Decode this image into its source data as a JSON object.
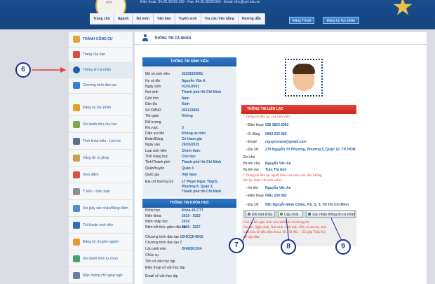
{
  "header": {
    "contact": "Điện thoại: 84.28.38295.299 - Fax: 84.28.38250359 - Email: tthc@uef.edu.vn",
    "logo_year": "1976",
    "nav": [
      "Trang chủ",
      "Ngành",
      "Bộ môn",
      "Văn bản",
      "Tuyển sinh",
      "Tra cứu Văn bằng",
      "Hướng dẫn"
    ],
    "logout": "Đăng Thoát",
    "register": "Đăng ký học phần"
  },
  "sidebar": {
    "items": [
      {
        "label": "THÀNH CÔNG CỤ",
        "icon": "tools-icon"
      },
      {
        "label": "Trang của bạn",
        "icon": "home-icon"
      },
      {
        "label": "Thông tin cá nhân",
        "icon": "user-icon"
      },
      {
        "label": "Chương trình đào tạo",
        "icon": "program-icon"
      },
      {
        "label": "Đăng ký học phần",
        "icon": "pencil-icon"
      },
      {
        "label": "Ghi danh nhu cầu học",
        "icon": "notebook-icon"
      },
      {
        "label": "Thời khóa biểu - Lịch thi",
        "icon": "calendar-icon"
      },
      {
        "label": "Vắng thi có phép",
        "icon": "absence-icon"
      },
      {
        "label": "Xem điểm",
        "icon": "grades-icon"
      },
      {
        "label": "Ý kiến - thảo luận",
        "icon": "discussion-icon"
      },
      {
        "label": "Xin giấy xác nhận/Bảng điểm",
        "icon": "certificate-icon"
      },
      {
        "label": "Tài khoản sinh viên",
        "icon": "account-icon"
      },
      {
        "label": "Đăng ký chuyên ngành",
        "icon": "major-icon"
      },
      {
        "label": "Ghi danh môn tự chọn",
        "icon": "elective-icon"
      },
      {
        "label": "Nộp chứng chỉ ngoại ngữ",
        "icon": "language-icon"
      }
    ]
  },
  "main": {
    "title": "THÔNG TIN CÁ NHÂN",
    "student_head": "THÔNG TIN SINH VIÊN",
    "student_rows": [
      {
        "label": "Mã số sinh viên",
        "value": "31191020001"
      },
      {
        "label": "Họ và tên",
        "value": "Nguyễn Văn A"
      },
      {
        "label": "Ngày sinh",
        "value": "01/01/2001"
      },
      {
        "label": "Nơi sinh",
        "value": "Thành phố Hồ Chí Minh"
      },
      {
        "label": "Giới tính",
        "value": "Nam"
      },
      {
        "label": "Dân tộc",
        "value": "Kinh"
      },
      {
        "label": "Số CMND",
        "value": "025123456"
      },
      {
        "label": "Tôn giáo",
        "value": "Không"
      },
      {
        "label": "Đối tượng",
        "value": ""
      },
      {
        "label": "Khu vực",
        "value": "3"
      },
      {
        "label": "Diện ưu tiên",
        "value": "Không ưu tiên"
      },
      {
        "label": "Đoàn/Đảng",
        "value": "Có tham gia"
      },
      {
        "label": "Ngày vào",
        "value": "26/03/2015"
      },
      {
        "label": "Loại sinh viên",
        "value": "Chính thức"
      },
      {
        "label": "Tình trạng học",
        "value": "Còn học"
      },
      {
        "label": "Tỉnh/Thành phố",
        "value": "Thành phố Hồ Chí Minh"
      },
      {
        "label": "Quận/huyện",
        "value": "Quận 3"
      },
      {
        "label": "Quốc gia",
        "value": "Việt Nam"
      }
    ],
    "address_label": "Địa chỉ thường trú",
    "address_lines": [
      "17 Phạm Ngọc Thạch,",
      "Phường 6, Quận 3,",
      "Thành phố Hồ Chí Minh"
    ],
    "course_head": "THÔNG TIN KHÓA HỌC",
    "course_rows": [
      {
        "label": "Khóa học",
        "value": "Khóa 45-CTT"
      },
      {
        "label": "Niên khóa",
        "value": "2019 - 2023"
      },
      {
        "label": "Năm nhập học",
        "value": "2019"
      },
      {
        "label": "Năm kết thúc giảm đào tạo",
        "value": "2019 - 2027"
      },
      {
        "label": "Chương trình đào tạo 1",
        "value": "DHCQK45KE"
      },
      {
        "label": "Chương trình đào tạo 2",
        "value": ""
      },
      {
        "label": "Lớp sinh viên",
        "value": "DH45DC054"
      },
      {
        "label": "Chức vụ",
        "value": ""
      },
      {
        "label": "Tên cố vấn học tập",
        "value": ""
      },
      {
        "label": "Điện thoại cố vấn học tập",
        "value": ""
      },
      {
        "label": "Email cố vấn học tập",
        "value": ""
      }
    ],
    "contact_head": "THÔNG TIN LIÊN LẠC",
    "contact_note1": "* Thông tin liên lạc của sinh viên:",
    "contact_rows": [
      {
        "label": "- Điện thoại",
        "value": "028 3823 6082"
      },
      {
        "label": "- Di động",
        "value": "0902 230 682"
      },
      {
        "label": "- Email",
        "value": "nguyenvana@gmail.com"
      },
      {
        "label": "- Địa chỉ",
        "value": "279 Nguyễn Tri Phương, Phường 5, Quận 10, TP. HCM"
      },
      {
        "label": "Ghi chú",
        "value": ""
      },
      {
        "label": "Họ tên cha",
        "value": "Nguyễn Văn An"
      },
      {
        "label": "Họ tên mẹ",
        "value": "Trần Thị Anh"
      }
    ],
    "contact_note2_lines": [
      "* Thông tin liên lạc người thân của sinh viên (khi không",
      "liên lạc được với sinh viên):"
    ],
    "relative_rows": [
      {
        "label": "- Họ tên",
        "value": "Nguyễn Văn An"
      },
      {
        "label": "- Điện thoại",
        "value": "0941 230 082"
      },
      {
        "label": "- Địa chỉ",
        "value": "59C Nguyễn Đình Chiểu, P.6, Q. 3, TP. Hồ Chí Minh"
      }
    ],
    "buttons": {
      "change_password": "Đổi mật khẩu",
      "update": "Cập nhật",
      "confirm_contact": "Xác nhận thông tin cá nhân"
    },
    "note_lines": [
      "Chú ý: Đề nghị sinh viên kiểm tra 04 thông tin:",
      "Họ tên, Ngày sinh, Nơi sinh, Giới tính. Nếu có sai sót, sinh",
      "viên liên hệ đến điện thoại: 38 230 082 - 152 gặp Thầy Kỳ",
      "để cập nhật"
    ]
  },
  "markers": [
    "6",
    "7",
    "8",
    "9"
  ],
  "colors": {
    "header_bg": "#1a4d8f",
    "panel_blue": "#1e5fa8",
    "panel_red": "#d23127",
    "marker": "#1d2b94",
    "arrow": "#e63b3b"
  }
}
